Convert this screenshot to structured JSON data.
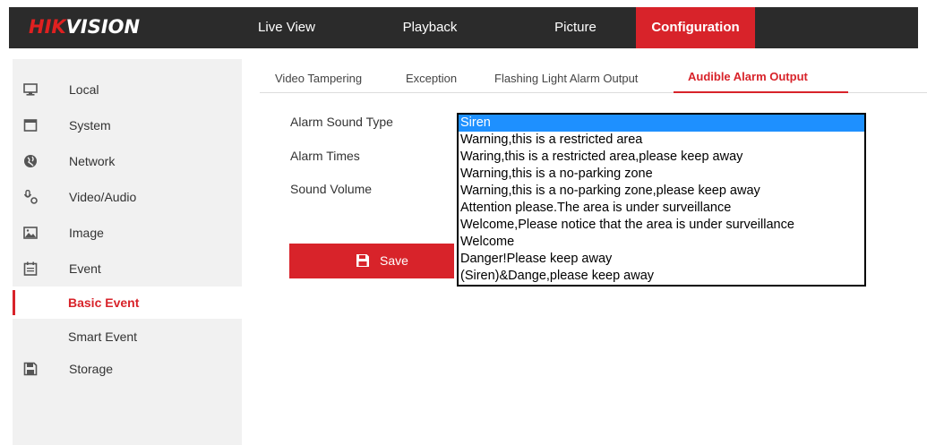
{
  "brand": {
    "part1": "HIK",
    "part2": "VISION"
  },
  "top_nav": [
    {
      "label": "Live View"
    },
    {
      "label": "Playback"
    },
    {
      "label": "Picture"
    },
    {
      "label": "Configuration",
      "active": true
    }
  ],
  "sidebar": {
    "items": [
      {
        "label": "Local",
        "icon": "monitor-icon"
      },
      {
        "label": "System",
        "icon": "window-icon"
      },
      {
        "label": "Network",
        "icon": "globe-icon"
      },
      {
        "label": "Video/Audio",
        "icon": "mic-camera-icon"
      },
      {
        "label": "Image",
        "icon": "picture-icon"
      },
      {
        "label": "Event",
        "icon": "calendar-icon"
      }
    ],
    "sub_items": [
      {
        "label": "Basic Event",
        "active": true
      },
      {
        "label": "Smart Event"
      }
    ],
    "storage": {
      "label": "Storage",
      "icon": "floppy-icon"
    }
  },
  "tabs": [
    {
      "label": "Video Tampering"
    },
    {
      "label": "Exception"
    },
    {
      "label": "Flashing Light Alarm Output"
    },
    {
      "label": "Audible Alarm Output",
      "active": true
    }
  ],
  "form": {
    "alarm_sound_type_label": "Alarm Sound Type",
    "alarm_times_label": "Alarm Times",
    "sound_volume_label": "Sound Volume",
    "alarm_sound_options": [
      "Siren",
      "Warning,this is a restricted area",
      "Waring,this is a restricted area,please keep away",
      "Warning,this is a no-parking zone",
      "Warning,this is a no-parking zone,please keep away",
      "Attention please.The area is under surveillance",
      "Welcome,Please notice that the area is under surveillance",
      "Welcome",
      "Danger!Please keep away",
      "(Siren)&Dange,please keep away"
    ],
    "selected_option": "Siren",
    "save_label": "Save"
  },
  "colors": {
    "accent": "#d8232a",
    "topbar": "#2b2b2b",
    "selection": "#1e90ff",
    "sidebar": "#f1f1f1"
  }
}
